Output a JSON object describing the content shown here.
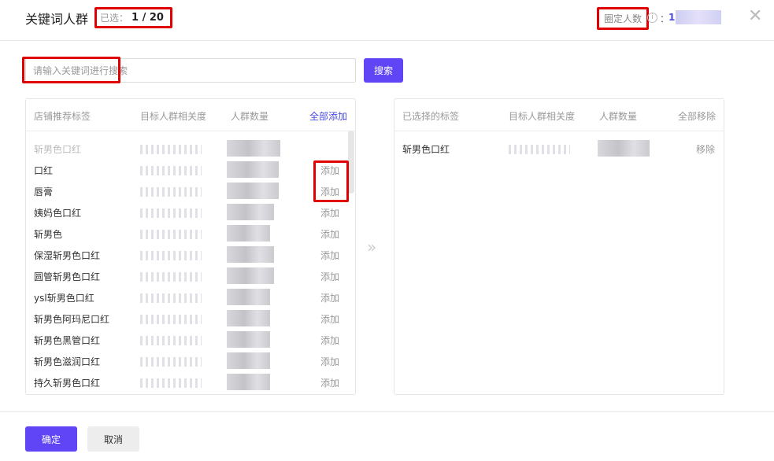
{
  "header": {
    "title": "关键词人群",
    "selected_label": "已选：",
    "selected_value": "1 / 20",
    "circled_label": "圈定人数",
    "info_icon": "info-icon",
    "circled_colon": "：",
    "circled_value_visible": "1",
    "close_icon": "close-icon"
  },
  "search": {
    "placeholder": "请输入关键词进行搜索",
    "value": "",
    "button_label": "搜索"
  },
  "left_panel": {
    "columns": {
      "tag": "店铺推荐标签",
      "relevance": "目标人群相关度",
      "population": "人群数量",
      "add_all": "全部添加"
    },
    "rows": [
      {
        "name": "斩男色口红",
        "action": "",
        "status": "selected"
      },
      {
        "name": "口红",
        "action": "添加"
      },
      {
        "name": "唇膏",
        "action": "添加"
      },
      {
        "name": "姨妈色口红",
        "action": "添加"
      },
      {
        "name": "斩男色",
        "action": "添加"
      },
      {
        "name": "保湿斩男色口红",
        "action": "添加"
      },
      {
        "name": "圆管斩男色口红",
        "action": "添加"
      },
      {
        "name": "ysl斩男色口红",
        "action": "添加"
      },
      {
        "name": "斩男色阿玛尼口红",
        "action": "添加"
      },
      {
        "name": "斩男色黑管口红",
        "action": "添加"
      },
      {
        "name": "斩男色滋润口红",
        "action": "添加"
      },
      {
        "name": "持久斩男色口红",
        "action": "添加"
      }
    ]
  },
  "transfer_icon": "double-chevron-right-icon",
  "right_panel": {
    "columns": {
      "tag": "已选择的标签",
      "relevance": "目标人群相关度",
      "population": "人群数量",
      "remove_all": "全部移除"
    },
    "rows": [
      {
        "name": "斩男色口红",
        "action": "移除"
      }
    ]
  },
  "footer": {
    "ok_label": "确定",
    "cancel_label": "取消"
  },
  "colors": {
    "accent": "#5f45f5",
    "link": "#4a4adf",
    "highlight": "#e00000"
  }
}
